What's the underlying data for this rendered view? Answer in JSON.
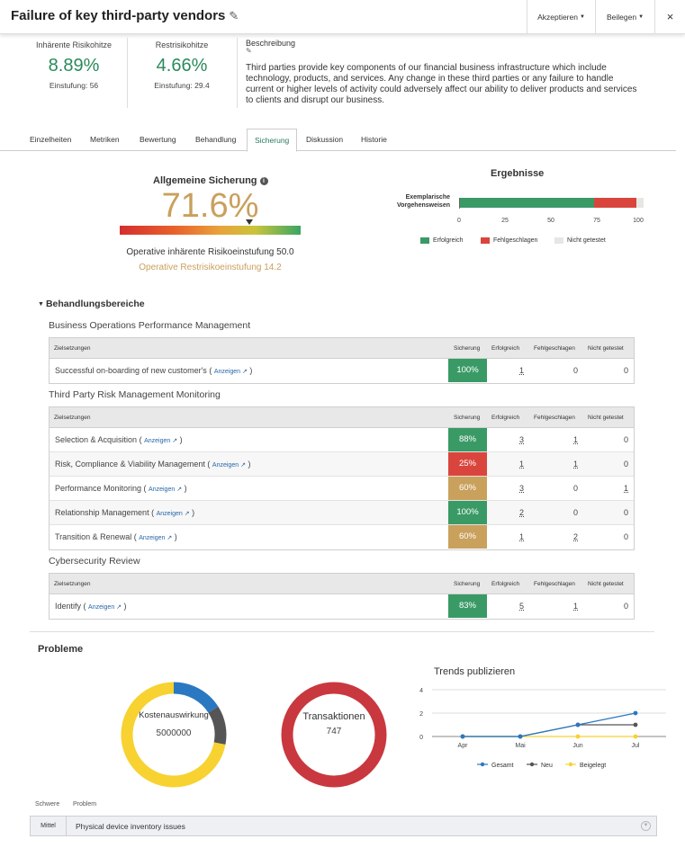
{
  "header": {
    "title": "Failure of key third-party vendors",
    "accept_label": "Akzeptieren",
    "settle_label": "Beilegen",
    "close_label": "×"
  },
  "metrics": {
    "inherent": {
      "label": "Inhärente Risikohitze",
      "value": "8.89%",
      "rating": "Einstufung: 56"
    },
    "residual": {
      "label": "Restrisikohitze",
      "value": "4.66%",
      "rating": "Einstufung: 29.4"
    }
  },
  "description": {
    "label": "Beschreibung",
    "text": "Third parties provide key components of our financial business infrastructure which include technology, products, and services. Any change in these third parties or any failure to handle current or higher levels of activity could adversely affect our ability to deliver products and services to clients and disrupt our business."
  },
  "tabs": [
    "Einzelheiten",
    "Metriken",
    "Bewertung",
    "Behandlung",
    "Sicherung",
    "Diskussion",
    "Historie"
  ],
  "active_tab": "Sicherung",
  "assurance": {
    "title": "Allgemeine Sicherung",
    "value": "71.6%",
    "level": 0.716,
    "operative_inherent": "Operative inhärente Risikoeinstufung 50.0",
    "operative_residual": "Operative Restrisikoeinstufung 14.2"
  },
  "results": {
    "title": "Ergebnisse",
    "row_label": "Exemplarische Vorgehensweisen",
    "passed": 73,
    "failed": 23,
    "not_tested": 4,
    "ticks": [
      "0",
      "25",
      "50",
      "75",
      "100"
    ],
    "legend": [
      "Erfolgreich",
      "Fehlgeschlagen",
      "Nicht getestet"
    ],
    "colors": {
      "passed": "#3a9a66",
      "failed": "#d9453d",
      "not_tested": "#e6e6e3"
    }
  },
  "treatment": {
    "title": "Behandlungsbereiche",
    "columns": [
      "Zielsetzungen",
      "Sicherung",
      "Erfolgreich",
      "Fehlgeschlagen",
      "Nicht getestet"
    ],
    "link_label": "Anzeigen",
    "groups": [
      {
        "name": "Business Operations Performance Management",
        "rows": [
          {
            "objective": "Successful on-boarding of new customer's",
            "assurance": "100%",
            "color": "#3a9a66",
            "passed": "1",
            "failed": "0",
            "not_tested": "0"
          }
        ]
      },
      {
        "name": "Third Party Risk Management Monitoring",
        "rows": [
          {
            "objective": "Selection & Acquisition",
            "assurance": "88%",
            "color": "#3a9a66",
            "passed": "3",
            "failed": "1",
            "not_tested": "0"
          },
          {
            "objective": "Risk, Compliance & Viability Management",
            "assurance": "25%",
            "color": "#d9453d",
            "passed": "1",
            "failed": "1",
            "not_tested": "0"
          },
          {
            "objective": "Performance Monitoring",
            "assurance": "60%",
            "color": "#c9a05c",
            "passed": "3",
            "failed": "0",
            "not_tested": "1"
          },
          {
            "objective": "Relationship Management",
            "assurance": "100%",
            "color": "#3a9a66",
            "passed": "2",
            "failed": "0",
            "not_tested": "0"
          },
          {
            "objective": "Transition & Renewal",
            "assurance": "60%",
            "color": "#c9a05c",
            "passed": "1",
            "failed": "2",
            "not_tested": "0"
          }
        ]
      },
      {
        "name": "Cybersecurity Review",
        "rows": [
          {
            "objective": "Identify",
            "assurance": "83%",
            "color": "#3a9a66",
            "passed": "5",
            "failed": "1",
            "not_tested": "0"
          }
        ]
      }
    ]
  },
  "problems": {
    "title": "Probleme",
    "cost_label": "Kostenauswirkung",
    "cost_value": "5000000",
    "tx_label": "Transaktionen",
    "tx_value": "747",
    "trend_title": "Trends publizieren",
    "table_headers": [
      "Schwere",
      "Problem"
    ],
    "rows": [
      {
        "severity": "Mittel",
        "problem": "Physical device inventory issues"
      }
    ]
  },
  "donut_cost": {
    "segments": [
      {
        "value": 0.16,
        "color": "#2a78c2"
      },
      {
        "value": 0.12,
        "color": "#555555"
      },
      {
        "value": 0.72,
        "color": "#f7d230"
      }
    ]
  },
  "donut_tx": {
    "segments": [
      {
        "value": 1.0,
        "color": "#c9383f"
      }
    ]
  },
  "chart_data": {
    "type": "line",
    "title": "Trends publizieren",
    "categories": [
      "Apr",
      "Mai",
      "Jun",
      "Jul"
    ],
    "yticks": [
      "0",
      "2",
      "4"
    ],
    "ylim": [
      0,
      4
    ],
    "series": [
      {
        "name": "Gesamt",
        "values": [
          0,
          0,
          1,
          2
        ],
        "color": "#2a78c2"
      },
      {
        "name": "Neu",
        "values": [
          0,
          0,
          1,
          1
        ],
        "color": "#555555"
      },
      {
        "name": "Beigelegt",
        "values": [
          0,
          0,
          0,
          0
        ],
        "color": "#f7d230"
      }
    ],
    "legend": "bottom"
  }
}
